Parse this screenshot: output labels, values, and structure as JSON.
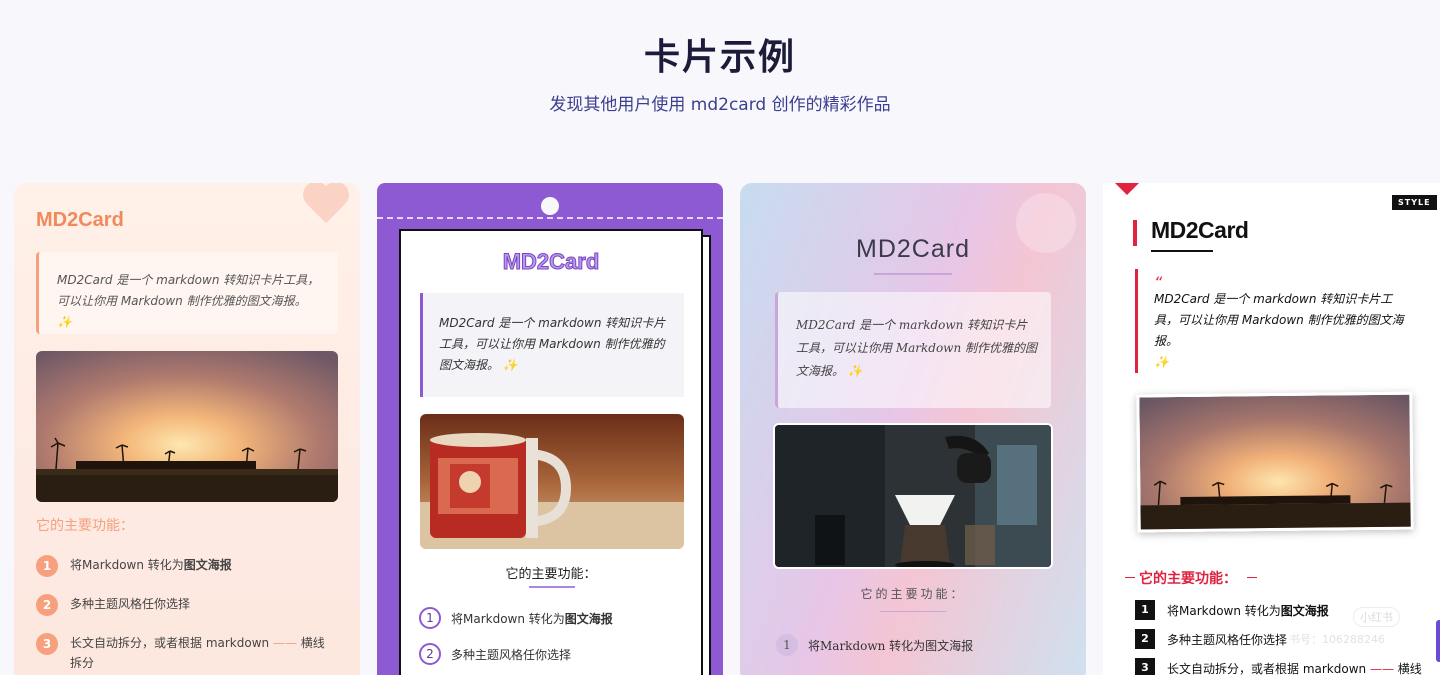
{
  "header": {
    "title": "卡片示例",
    "subtitle": "发现其他用户使用 md2card 创作的精彩作品"
  },
  "brand": "MD2Card",
  "brand_alt": "MD2Card",
  "brand_caps": "MD2Card",
  "quote": {
    "text": "MD2Card 是一个 markdown 转知识卡片工具，可以让你用 Markdown 制作优雅的图文海报。",
    "sparkle": "✨"
  },
  "features": {
    "title": "它的主要功能：",
    "items": [
      {
        "num": "1",
        "text": "将Markdown 转化为",
        "bold": "图文海报"
      },
      {
        "num": "2",
        "text": "多种主题风格任你选择"
      },
      {
        "num": "3",
        "text": "长文自动拆分，或者根据 markdown",
        "dash": "——",
        "tail": "横线拆分",
        "tail_short": "横线"
      }
    ]
  },
  "card4": {
    "style_tag": "STYLE",
    "quote_mark": "“",
    "watermark_1": "小红书",
    "watermark_2": "书号：106288246"
  },
  "colors": {
    "peach": "#f08a5d",
    "purple": "#8e5ad3",
    "red": "#e0233f"
  }
}
